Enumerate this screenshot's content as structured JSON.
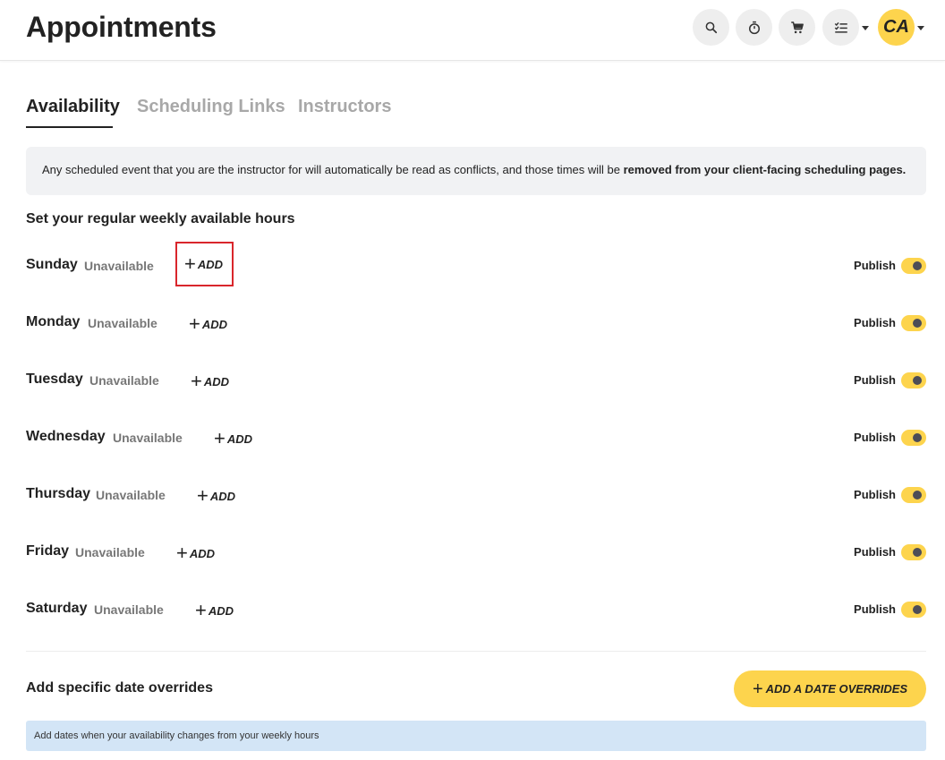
{
  "header": {
    "title": "Appointments",
    "avatar_initials": "CA",
    "icons": [
      "search-icon",
      "stopwatch-icon",
      "cart-icon",
      "checklist-icon"
    ]
  },
  "tabs": [
    {
      "label": "Availability",
      "active": true
    },
    {
      "label": "Scheduling Links",
      "active": false
    },
    {
      "label": "Instructors",
      "active": false
    }
  ],
  "notice": {
    "text": "Any scheduled event that you are the instructor for will automatically be read as conflicts, and those times will be ",
    "bold": "removed from your client-facing scheduling pages."
  },
  "weekly": {
    "title": "Set your regular weekly available hours",
    "add_label": "ADD",
    "publish_label": "Publish",
    "days": [
      {
        "name": "Sunday",
        "status": "Unavailable",
        "published": true
      },
      {
        "name": "Monday",
        "status": "Unavailable",
        "published": true
      },
      {
        "name": "Tuesday",
        "status": "Unavailable",
        "published": true
      },
      {
        "name": "Wednesday",
        "status": "Unavailable",
        "published": true
      },
      {
        "name": "Thursday",
        "status": "Unavailable",
        "published": true
      },
      {
        "name": "Friday",
        "status": "Unavailable",
        "published": true
      },
      {
        "name": "Saturday",
        "status": "Unavailable",
        "published": true
      }
    ]
  },
  "overrides": {
    "title": "Add specific date overrides",
    "button_label": "ADD A DATE OVERRIDES",
    "info": "Add dates when your availability changes from your weekly hours"
  },
  "colors": {
    "accent": "#fdd44d",
    "highlight_border": "#d9262c",
    "info_bg": "#d3e5f6"
  }
}
